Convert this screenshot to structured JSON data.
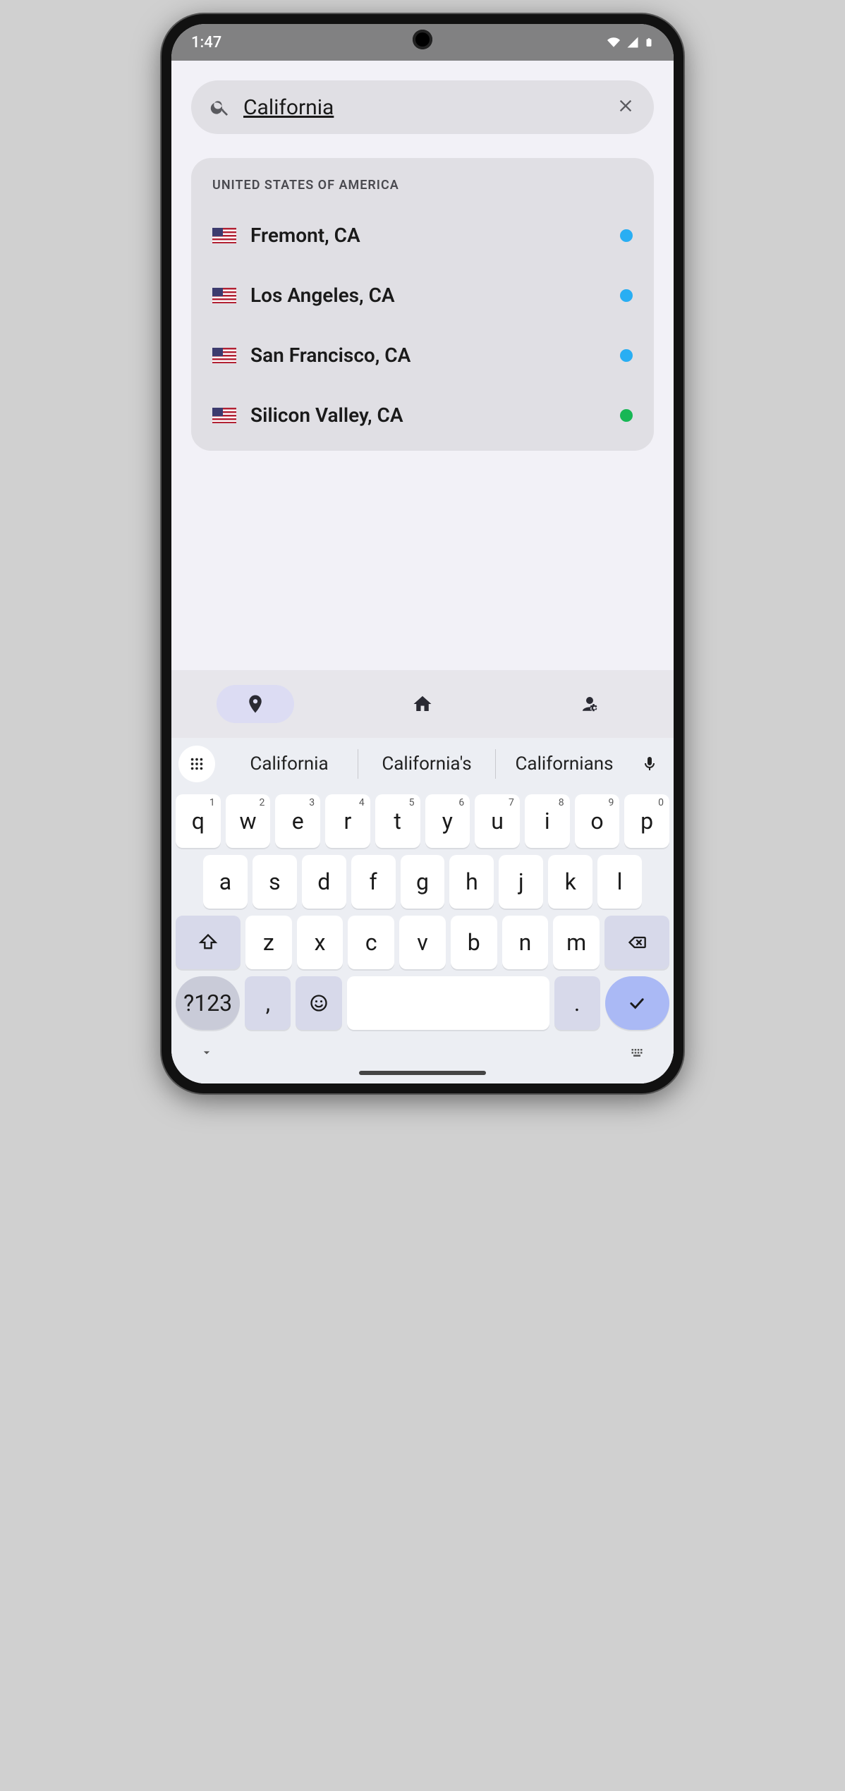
{
  "status": {
    "time": "1:47"
  },
  "search": {
    "value": "California",
    "placeholder": "Search"
  },
  "results": {
    "header": "UNITED STATES OF AMERICA",
    "items": [
      {
        "label": "Fremont, CA",
        "status": "blue"
      },
      {
        "label": "Los Angeles, CA",
        "status": "blue"
      },
      {
        "label": "San Francisco, CA",
        "status": "blue"
      },
      {
        "label": "Silicon Valley, CA",
        "status": "green"
      }
    ]
  },
  "nav": {
    "active": 0
  },
  "keyboard": {
    "suggestions": [
      "California",
      "California's",
      "Californians"
    ],
    "row1": [
      {
        "k": "q",
        "n": "1"
      },
      {
        "k": "w",
        "n": "2"
      },
      {
        "k": "e",
        "n": "3"
      },
      {
        "k": "r",
        "n": "4"
      },
      {
        "k": "t",
        "n": "5"
      },
      {
        "k": "y",
        "n": "6"
      },
      {
        "k": "u",
        "n": "7"
      },
      {
        "k": "i",
        "n": "8"
      },
      {
        "k": "o",
        "n": "9"
      },
      {
        "k": "p",
        "n": "0"
      }
    ],
    "row2": [
      "a",
      "s",
      "d",
      "f",
      "g",
      "h",
      "j",
      "k",
      "l"
    ],
    "row3": [
      "z",
      "x",
      "c",
      "v",
      "b",
      "n",
      "m"
    ],
    "symKey": "?123",
    "commaKey": ",",
    "periodKey": "."
  }
}
